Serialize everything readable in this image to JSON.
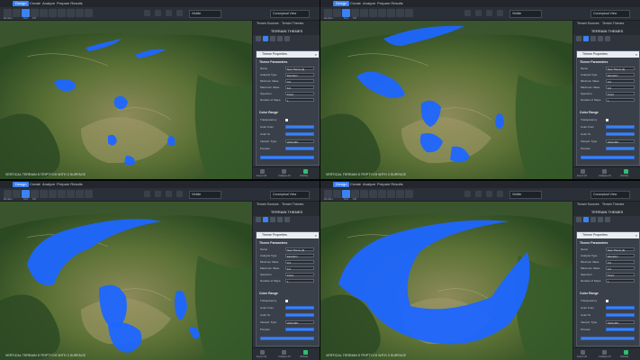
{
  "tabs": [
    "Design",
    "Create",
    "Analyze",
    "Prepare Results"
  ],
  "toolbar": {
    "labels": [
      "Render",
      "Cut",
      "Fill"
    ],
    "select_a": "Visible",
    "select_b": "Conceptual View"
  },
  "panel": {
    "tabs": [
      "Terrain Sources",
      "Terrain Themes"
    ],
    "header": "TERRAIN THEMES",
    "dialog_title": "Theme Properties",
    "close": "×",
    "section_params": "Theme Parameters",
    "fields": [
      {
        "label": "Name",
        "value": "New Theme (2)"
      },
      {
        "label": "Analysis Type",
        "value": "Elevation"
      },
      {
        "label": "Minimum Value",
        "value": "0.0"
      },
      {
        "label": "Maximum Value",
        "value": "6.0"
      },
      {
        "label": "Spectrum",
        "value": "Fixed"
      },
      {
        "label": "Number of Steps",
        "value": "1"
      }
    ],
    "section_color": "Color Range",
    "color_fields": [
      {
        "label": "Transparency"
      },
      {
        "label": "Color From"
      },
      {
        "label": "Color To"
      },
      {
        "label": "Interpol. Type",
        "value": "HSV-HSV"
      },
      {
        "label": "Preview"
      }
    ],
    "footer": [
      "Export All",
      "Collapse All",
      "Visibility"
    ]
  },
  "status": "VERTICAL TERRAIN 5 TRIPTYCH WITH 3 SURFACE",
  "colors": {
    "water": "#1e66ff",
    "accent": "#3b82f6",
    "panel_bg": "#30353d"
  },
  "quads": [
    {
      "stage": 1
    },
    {
      "stage": 2
    },
    {
      "stage": 3
    },
    {
      "stage": 4
    }
  ]
}
